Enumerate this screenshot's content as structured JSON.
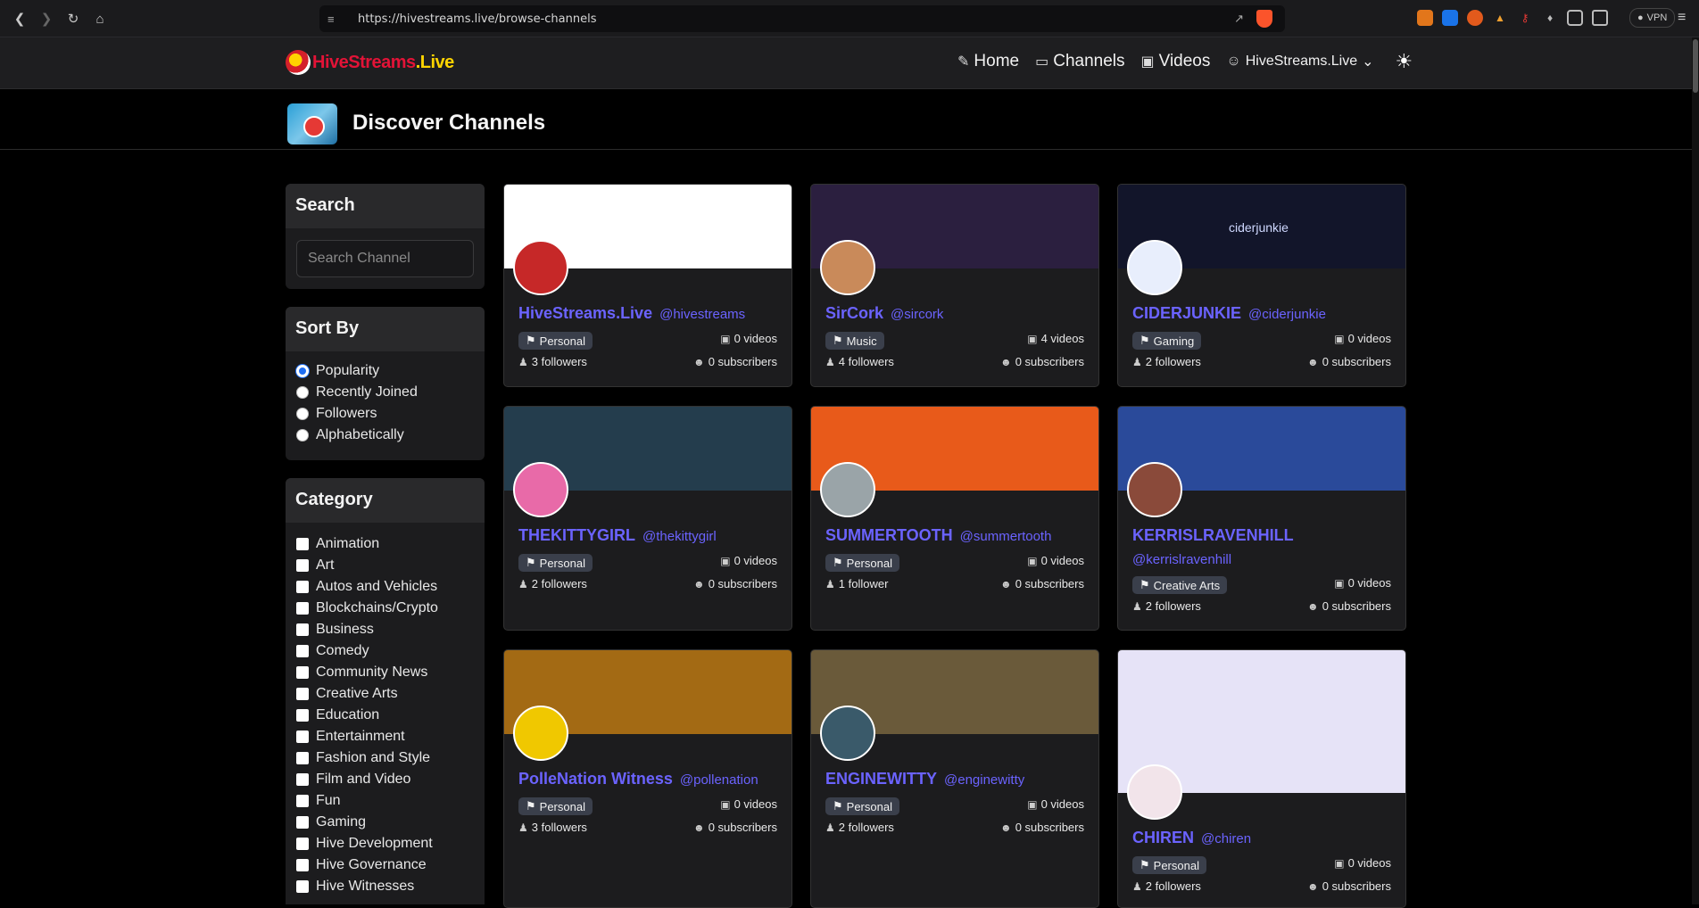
{
  "browser": {
    "url": "https://hivestreams.live/browse-channels",
    "vpn_label": "VPN"
  },
  "header": {
    "logo_part1": "HiveStreams",
    "logo_part2": ".Live",
    "nav": [
      {
        "label": "Home",
        "icon": "edit-icon"
      },
      {
        "label": "Channels",
        "icon": "cast-icon"
      },
      {
        "label": "Videos",
        "icon": "video-icon"
      }
    ],
    "user_label": "HiveStreams.Live"
  },
  "page": {
    "title": "Discover Channels"
  },
  "sidebar": {
    "search": {
      "heading": "Search",
      "placeholder": "Search Channel"
    },
    "sort": {
      "heading": "Sort By",
      "options": [
        "Popularity",
        "Recently Joined",
        "Followers",
        "Alphabetically"
      ],
      "selected": "Popularity"
    },
    "category": {
      "heading": "Category",
      "options": [
        "Animation",
        "Art",
        "Autos and Vehicles",
        "Blockchains/Crypto",
        "Business",
        "Comedy",
        "Community News",
        "Creative Arts",
        "Education",
        "Entertainment",
        "Fashion and Style",
        "Film and Video",
        "Fun",
        "Gaming",
        "Hive Development",
        "Hive Governance",
        "Hive Witnesses"
      ]
    }
  },
  "channels": [
    {
      "name": "HiveStreams.Live",
      "handle": "@hivestreams",
      "category": "Personal",
      "videos": "0 videos",
      "followers": "3 followers",
      "subscribers": "0 subscribers",
      "banner_color": "#ffffff",
      "avatar_color": "#c62828"
    },
    {
      "name": "SirCork",
      "handle": "@sircork",
      "category": "Music",
      "videos": "4 videos",
      "followers": "4 followers",
      "subscribers": "0 subscribers",
      "banner_color": "#2b1f3f",
      "avatar_color": "#c98a5a"
    },
    {
      "name": "CIDERJUNKIE",
      "handle": "@ciderjunkie",
      "category": "Gaming",
      "videos": "0 videos",
      "followers": "2 followers",
      "subscribers": "0 subscribers",
      "banner_color": "#12152a",
      "banner_text": "ciderjunkie",
      "avatar_color": "#e8eefc"
    },
    {
      "name": "THEKITTYGIRL",
      "handle": "@thekittygirl",
      "category": "Personal",
      "videos": "0 videos",
      "followers": "2 followers",
      "subscribers": "0 subscribers",
      "banner_color": "#243d4d",
      "avatar_color": "#e86aa8"
    },
    {
      "name": "SUMMERTOOTH",
      "handle": "@summertooth",
      "category": "Personal",
      "videos": "0 videos",
      "followers": "1 follower",
      "subscribers": "0 subscribers",
      "banner_color": "#e85a1a",
      "avatar_color": "#9aa4a8"
    },
    {
      "name": "KERRISLRAVENHILL",
      "handle": "@kerrislravenhill",
      "category": "Creative Arts",
      "videos": "0 videos",
      "followers": "2 followers",
      "subscribers": "0 subscribers",
      "banner_color": "#2a4a9a",
      "avatar_color": "#8a4a3a"
    },
    {
      "name": "PolleNation Witness",
      "handle": "@pollenation",
      "category": "Personal",
      "videos": "0 videos",
      "followers": "3 followers",
      "subscribers": "0 subscribers",
      "banner_color": "#a36a14",
      "avatar_color": "#f0c800"
    },
    {
      "name": "ENGINEWITTY",
      "handle": "@enginewitty",
      "category": "Personal",
      "videos": "0 videos",
      "followers": "2 followers",
      "subscribers": "0 subscribers",
      "banner_color": "#6a5a3a",
      "avatar_color": "#3a5a6a"
    },
    {
      "name": "CHIREN",
      "handle": "@chiren",
      "category": "Personal",
      "videos": "0 videos",
      "followers": "2 followers",
      "subscribers": "0 subscribers",
      "banner_color": "#e6e3f7",
      "avatar_color": "#f2e4ea"
    }
  ]
}
